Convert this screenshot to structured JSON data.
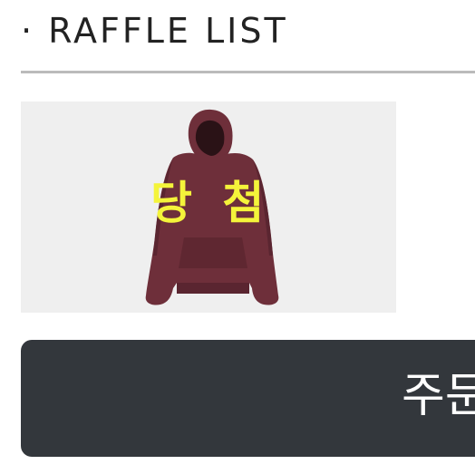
{
  "header": {
    "title": "· RAFFLE LIST"
  },
  "raffle_item": {
    "status_label": "당 첨",
    "image_icon": "hoodie-image",
    "product_color": "#6e2f3a"
  },
  "order_button": {
    "label": "주문"
  },
  "colors": {
    "status_label": "#f4f43a",
    "button_bg": "#33373c",
    "divider": "#bbbbbb",
    "card_bg": "#efefef"
  }
}
